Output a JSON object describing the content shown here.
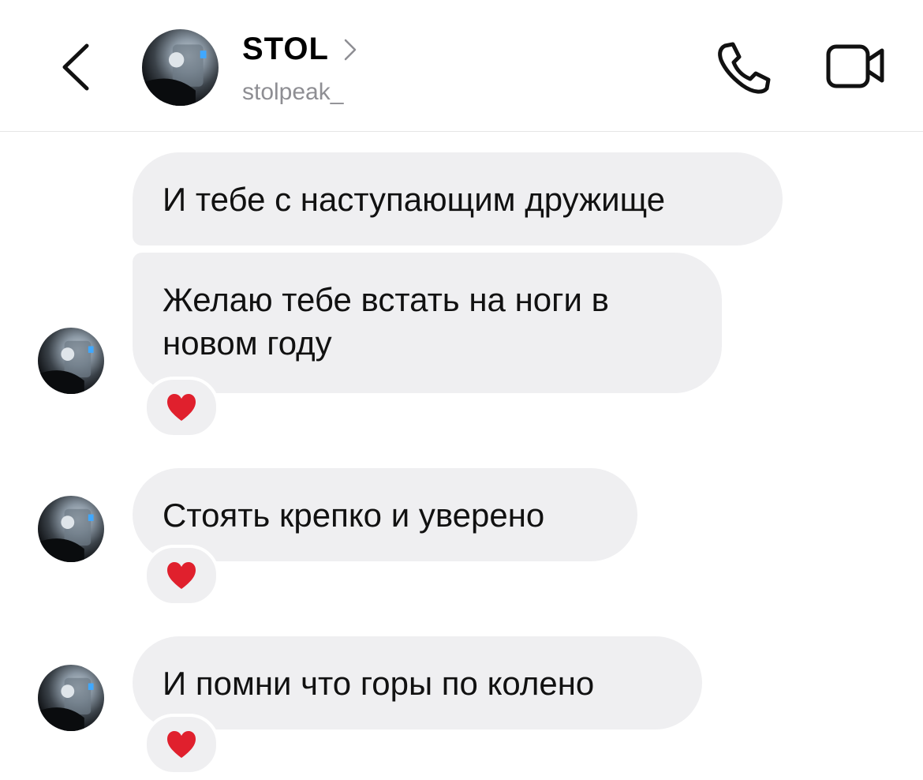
{
  "header": {
    "title": "STOL",
    "username": "stolpeak_",
    "back_icon": "chevron-left-icon",
    "title_chevron_icon": "chevron-right-icon",
    "call_icon": "phone-icon",
    "video_icon": "video-camera-icon"
  },
  "messages": [
    {
      "text": "И тебе с наступающим дружище",
      "reaction": null
    },
    {
      "text": "Желаю тебе встать на ноги в новом году",
      "reaction": "heart"
    },
    {
      "text": "Стоять крепко и уверено",
      "reaction": "heart"
    },
    {
      "text": "И помни что горы по колено",
      "reaction": "heart"
    }
  ],
  "colors": {
    "bubble": "#efeff1",
    "heart": "#e0202d",
    "secondary_text": "#8e8e93"
  }
}
